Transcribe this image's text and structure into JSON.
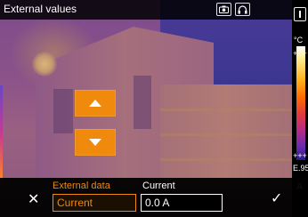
{
  "title": "External values",
  "toolbar": {
    "camera_icon": "camera-icon",
    "headset_icon": "headset-icon"
  },
  "scale": {
    "unit": "°C",
    "emissivity": "E.95",
    "mode": "A"
  },
  "controls": {
    "up_icon": "arrow-up-icon",
    "down_icon": "arrow-down-icon"
  },
  "bottom": {
    "external_data_label": "External data",
    "current_label": "Current",
    "selected_value": "Current",
    "current_value": "0.0 A"
  },
  "colors": {
    "accent": "#f08a0c"
  }
}
